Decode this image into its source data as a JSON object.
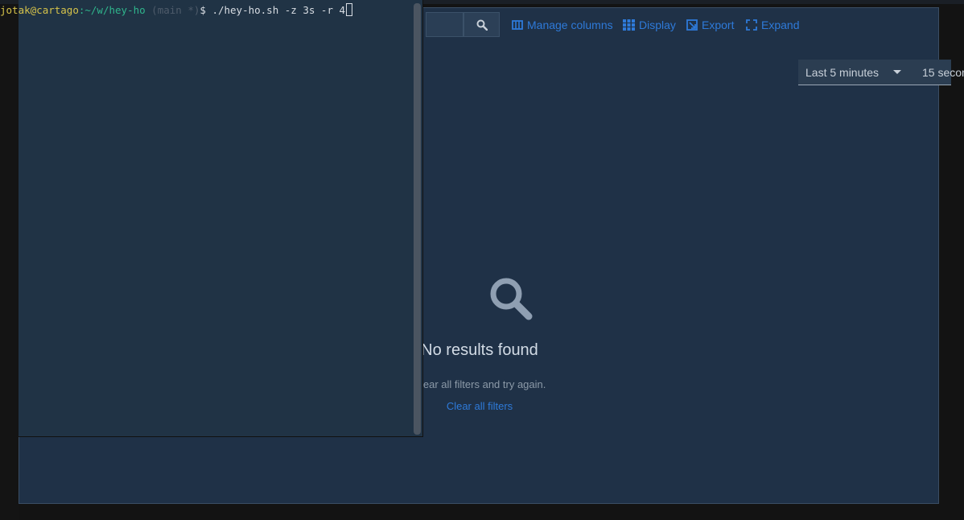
{
  "toolbar": {
    "manage_columns": "Manage columns",
    "display": "Display",
    "export": "Export",
    "expand": "Expand"
  },
  "time_range": {
    "selected": "Last 5 minutes",
    "refresh": "15 secon"
  },
  "empty_state": {
    "title": "No results found",
    "body": "Clear all filters and try again.",
    "action": "Clear all filters"
  },
  "terminal": {
    "user": "jotak",
    "host": "@cartago",
    "path": ":~/w/hey-ho",
    "branch": " (main *)",
    "prompt_symbol": "$ ",
    "command": "./hey-ho.sh -z 3s -r 4"
  },
  "colors": {
    "accent": "#2e7ad9",
    "panel_bg": "#1f3147",
    "terminal_bg": "#203345"
  },
  "icons": {
    "search": "search-icon",
    "columns": "manage-columns-icon",
    "display": "grid-icon",
    "export": "export-icon",
    "expand": "expand-icon",
    "empty": "magnifier-icon"
  }
}
